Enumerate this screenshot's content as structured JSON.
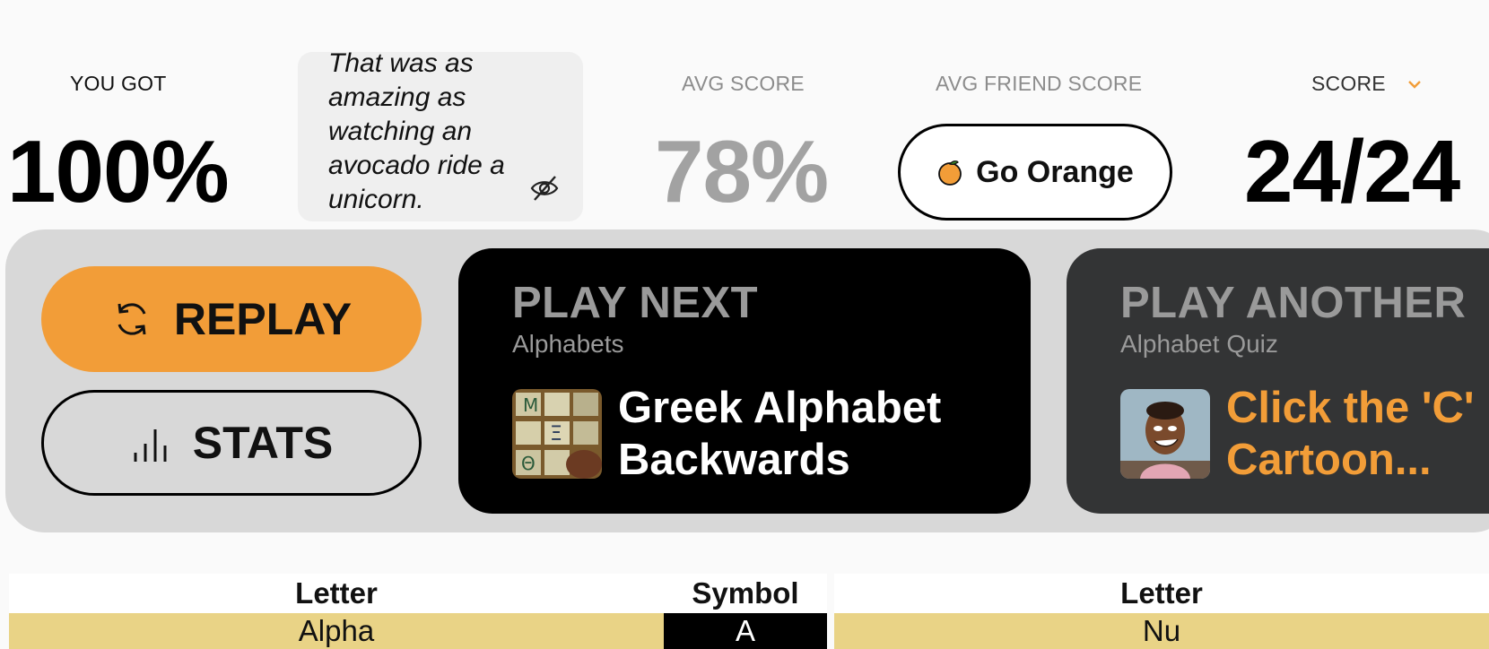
{
  "results": {
    "you_got_label": "YOU GOT",
    "you_got_value": "100%",
    "message": "That was as amazing as watching an avocado ride a unicorn.",
    "avg_score_label": "AVG SCORE",
    "avg_score_value": "78%",
    "avg_friend_label": "AVG FRIEND SCORE",
    "go_orange_label": "Go Orange",
    "score_label": "SCORE",
    "score_value": "24/24"
  },
  "actions": {
    "replay_label": "REPLAY",
    "stats_label": "STATS"
  },
  "play_next": {
    "heading": "PLAY NEXT",
    "category": "Alphabets",
    "title_line1": "Greek Alphabet",
    "title_line2": "Backwards"
  },
  "play_another": {
    "heading": "PLAY ANOTHER",
    "category": "Alphabet Quiz",
    "title_line1": "Click the 'C'",
    "title_line2": "Cartoon..."
  },
  "table": {
    "left": {
      "col1": "Letter",
      "col2": "Symbol",
      "rows": [
        {
          "letter": "Alpha",
          "symbol": "A"
        }
      ]
    },
    "right": {
      "col1": "Letter",
      "rows": [
        {
          "letter": "Nu"
        }
      ]
    }
  },
  "colors": {
    "accent": "#f29d38",
    "row_highlight": "#e9d386",
    "panel": "#d8d8d8"
  },
  "icons": [
    "eye-slash-icon",
    "orange-icon",
    "chevron-down-icon",
    "replay-icon",
    "stats-bars-icon"
  ]
}
